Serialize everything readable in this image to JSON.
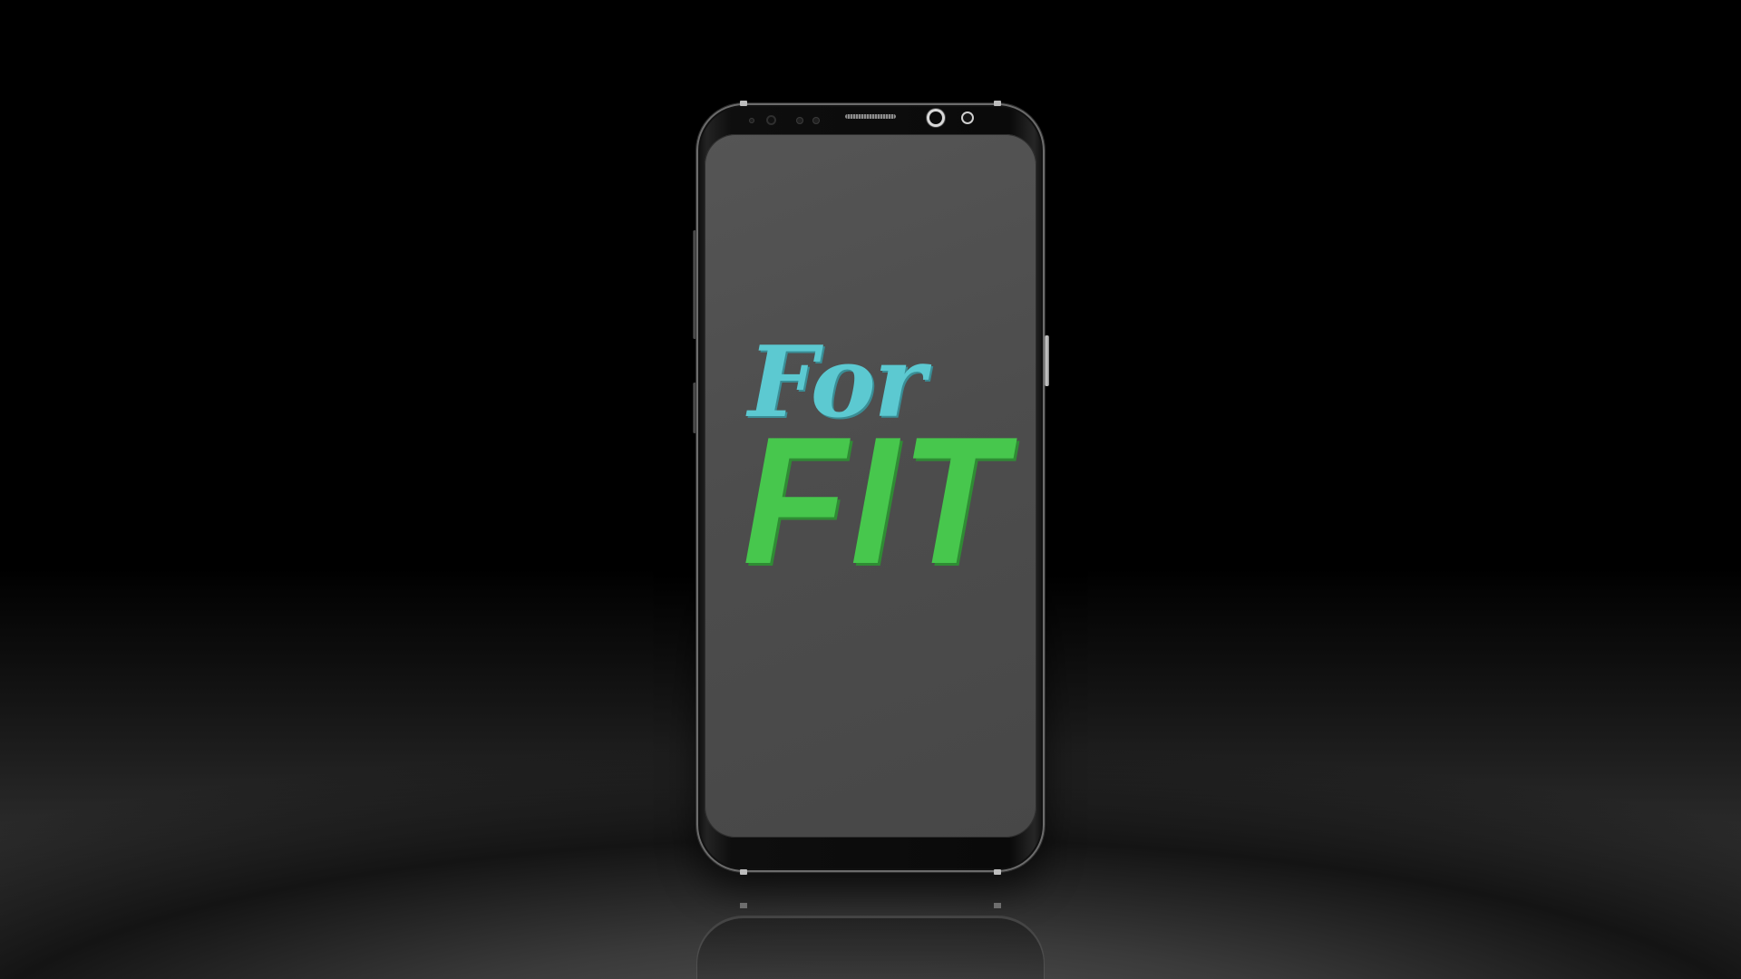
{
  "app": {
    "logo_line1": "For",
    "logo_line2": "FIT"
  },
  "colors": {
    "logo_line1": "#5cc9d1",
    "logo_line2": "#47c74d",
    "screen_background": "#4d4d4d",
    "backdrop": "#000000"
  },
  "device": {
    "type": "smartphone",
    "front_camera_icon": "camera-icon",
    "earpiece_icon": "speaker-grille-icon"
  }
}
